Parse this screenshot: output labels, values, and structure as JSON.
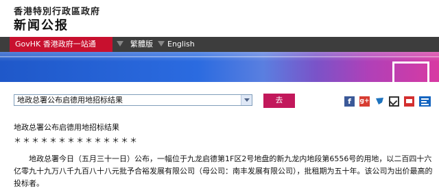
{
  "header": {
    "gov_name": "香港特別行政區政府",
    "site_title": "新闻公报"
  },
  "nav": {
    "govhk": "GovHK 香港政府一站通",
    "traditional": "繁體版",
    "english": "English"
  },
  "search": {
    "selected": "地政总署公布启德用地招标结果",
    "go_label": "去"
  },
  "share": {
    "facebook": "f",
    "gplus": "g+",
    "icons": [
      "facebook-icon",
      "google-plus-icon",
      "weibo-icon",
      "email-icon",
      "print-icon",
      "text-size-icon"
    ]
  },
  "article": {
    "title": "地政总署公布启德用地招标结果",
    "stars": "＊＊＊＊＊＊＊＊＊＊＊＊＊＊",
    "body": "　　地政总署今日（五月三十一日）公布，一幅位于九龙启德第1F区2号地盘的新九龙内地段第6556号的用地，以二百四十六亿零九十九万八千九百八十八元批予合裕发展有限公司（母公司：南丰发展有限公司），批租期为五十年。该公司为出价最高的投标者。"
  },
  "colors": {
    "nav_bg": "#3d3d3d",
    "govhk_red": "#c8102e",
    "go_button": "#c2185b"
  }
}
